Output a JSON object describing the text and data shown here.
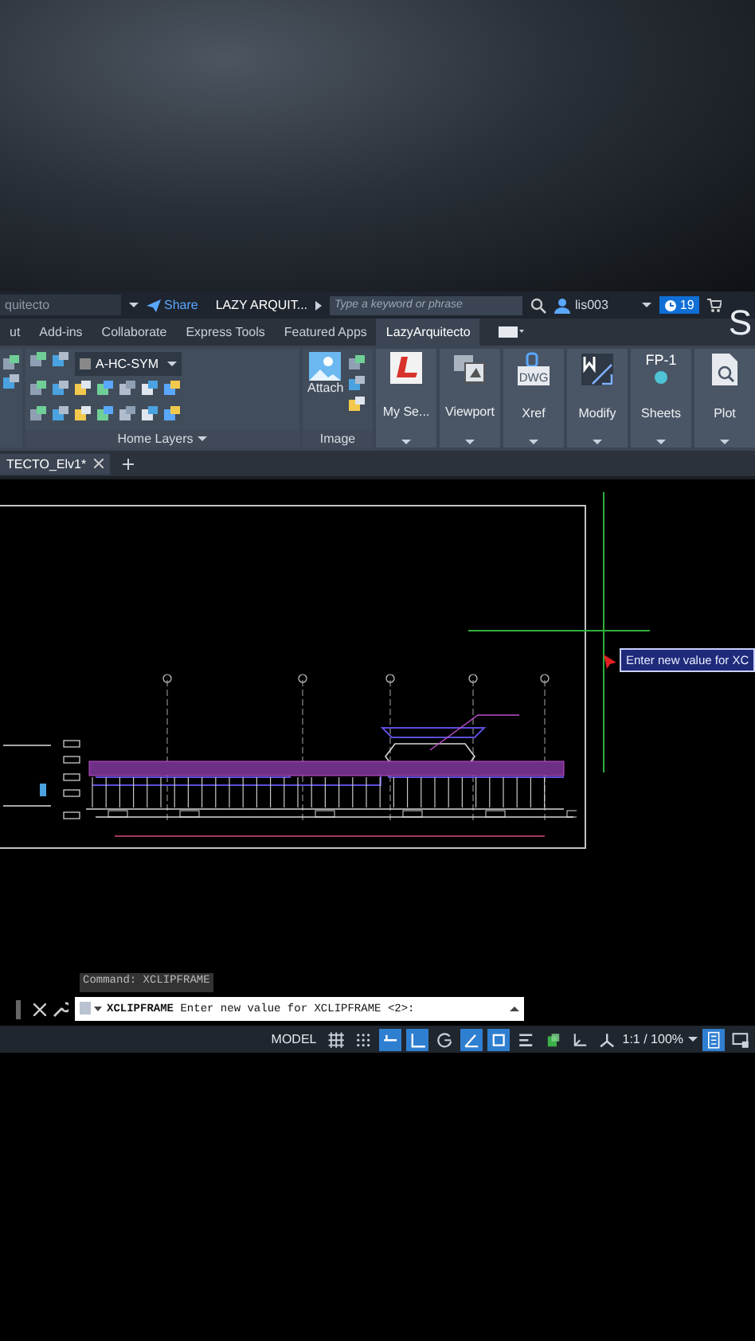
{
  "title_bar": {
    "workspace": "quitecto",
    "share": "Share",
    "file_title": "LAZY ARQUIT...",
    "search": {
      "placeholder": "Type a keyword or phrase"
    },
    "user": "lis003",
    "notifications": "19",
    "app_title": "S"
  },
  "ribbon": {
    "tabs": [
      {
        "label": "ut",
        "selected": false
      },
      {
        "label": "Add-ins",
        "selected": false
      },
      {
        "label": "Collaborate",
        "selected": false
      },
      {
        "label": "Express Tools",
        "selected": false
      },
      {
        "label": "Featured Apps",
        "selected": false
      },
      {
        "label": "LazyArquitecto",
        "selected": true
      }
    ],
    "layers_panel": {
      "layer": "A-HC-SYM",
      "label": "Home Layers"
    },
    "image_panel": {
      "button": "Attach",
      "label": "Image"
    },
    "tools": [
      {
        "label": "My Se...",
        "kind": "logo"
      },
      {
        "label": "Viewport",
        "kind": "viewport"
      },
      {
        "label": "Xref",
        "kind": "dwg",
        "icon_text": "DWG"
      },
      {
        "label": "Modify",
        "kind": "modify"
      },
      {
        "label": "Sheets",
        "kind": "sheet",
        "icon_text": "FP-1"
      },
      {
        "label": "Plot",
        "kind": "plot"
      }
    ]
  },
  "file_tabs": [
    {
      "label": "TECTO_Elv1*",
      "selected": true
    }
  ],
  "canvas": {
    "tooltip": "Enter new value for XC"
  },
  "command_line": {
    "history": "Command: XCLIPFRAME",
    "prompt": "**XCLIPFRAME** Enter new value for XCLIPFRAME <2>:"
  },
  "status_bar": {
    "space": "MODEL",
    "scale": "1:1 / 100%",
    "toggles": [
      {
        "kind": "grid",
        "on": false
      },
      {
        "kind": "snap",
        "on": false
      },
      {
        "kind": "infer",
        "on": true
      },
      {
        "kind": "ortho",
        "on": true
      },
      {
        "kind": "polar",
        "on": false
      },
      {
        "kind": "isodraft",
        "on": true
      },
      {
        "kind": "osnap",
        "on": true
      },
      {
        "kind": "lineweight",
        "on": false
      },
      {
        "kind": "transparency",
        "on": false
      },
      {
        "kind": "ucs",
        "on": false
      },
      {
        "kind": "annotation",
        "on": false
      }
    ],
    "end_toggles": [
      {
        "kind": "customize",
        "on": true
      },
      {
        "kind": "screen",
        "on": false
      }
    ]
  }
}
